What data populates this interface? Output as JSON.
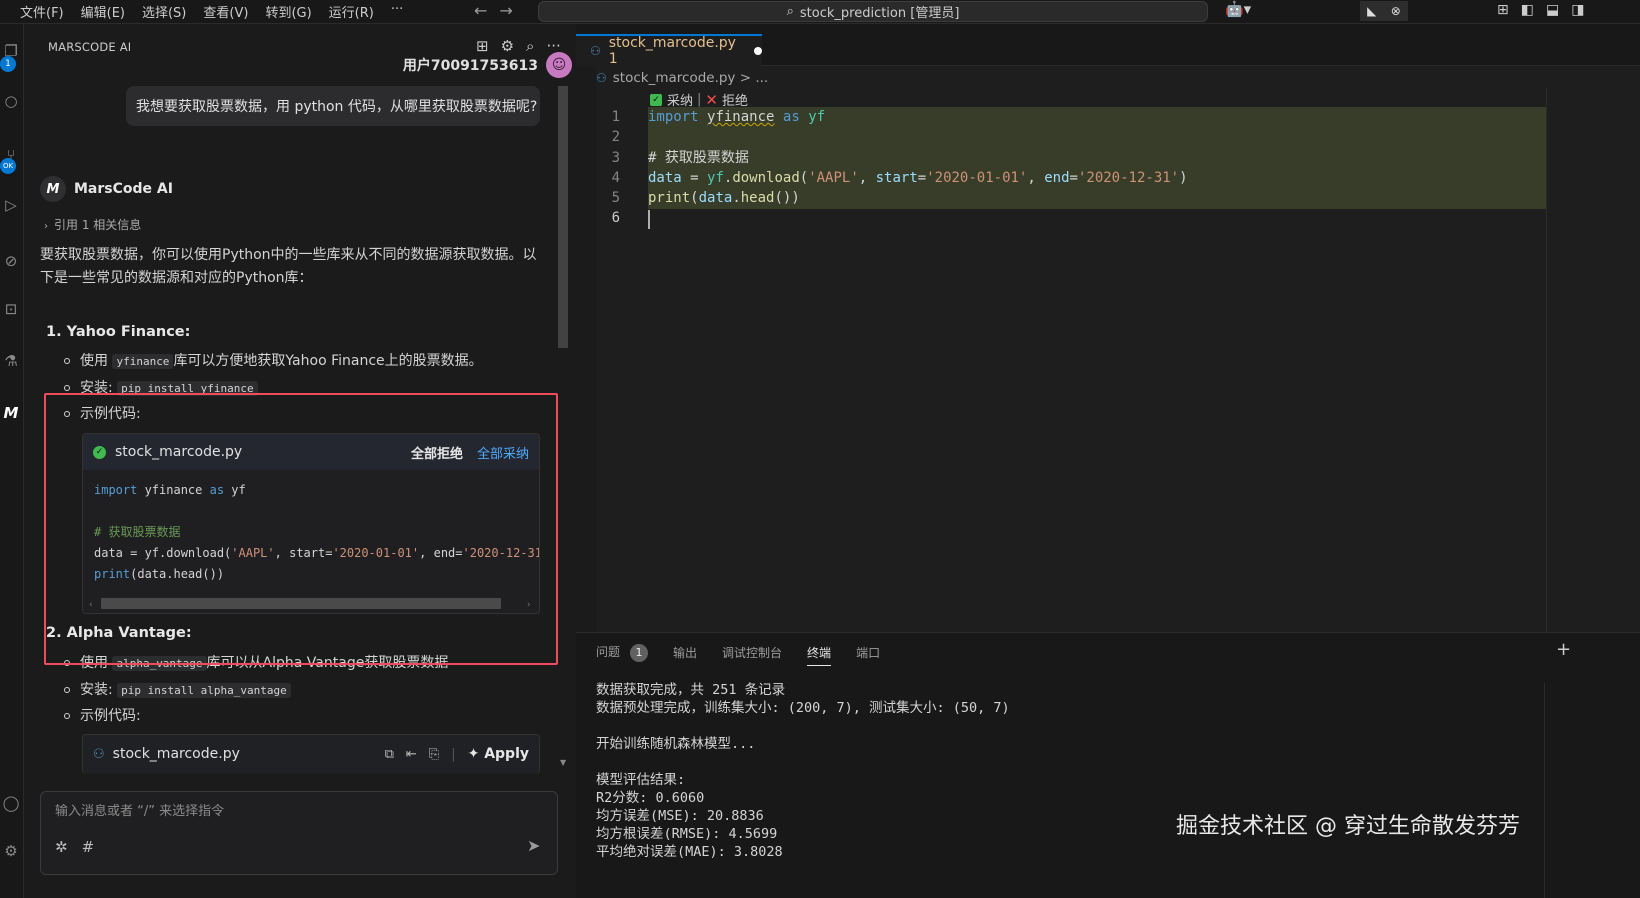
{
  "menu": [
    "文件(F)",
    "编辑(E)",
    "选择(S)",
    "查看(V)",
    "转到(G)",
    "运行(R)",
    "···"
  ],
  "search": {
    "title": "stock_prediction [管理员]"
  },
  "activity": {
    "badge_explorer": "1",
    "badge_ok": "OK"
  },
  "chat": {
    "header": "MARSCODE AI",
    "user_name": "用户70091753613",
    "user_message": "我想要获取股票数据，用 python 代码，从哪里获取股票数据呢?",
    "ai_name": "MarsCode AI",
    "ref_line": "引用 1 相关信息",
    "intro": "要获取股票数据，你可以使用Python中的一些库来从不同的数据源获取数据。以下是一些常见的数据源和对应的Python库：",
    "sections": [
      {
        "title": "1. Yahoo Finance:",
        "use_prefix": "使用",
        "use_code": "yfinance",
        "use_suffix": "库可以方便地获取Yahoo Finance上的股票数据。",
        "install_label": "安装:",
        "install_code": "pip install yfinance",
        "example_label": "示例代码:"
      },
      {
        "title": "2. Alpha Vantage:",
        "use_prefix": "使用",
        "use_code": "alpha_vantage",
        "use_suffix": "库可以从Alpha Vantage获取股票数据",
        "install_label": "安装:",
        "install_code": "pip install alpha_vantage",
        "example_label": "示例代码:"
      }
    ],
    "card1": {
      "filename": "stock_marcode.py",
      "reject_all": "全部拒绝",
      "accept_all": "全部采纳"
    },
    "card2": {
      "filename": "stock_marcode.py",
      "apply": "Apply"
    },
    "input_placeholder": "输入消息或者 “/” 来选择指令",
    "hash": "#"
  },
  "editor": {
    "tab_label": "stock_marcode.py 1",
    "breadcrumb": "stock_marcode.py > ...",
    "accept": "采纳",
    "separator": "|",
    "reject": "拒绝",
    "line_numbers": [
      "1",
      "2",
      "3",
      "4",
      "5",
      "6"
    ]
  },
  "panel": {
    "tabs": [
      "问题",
      "输出",
      "调试控制台",
      "终端",
      "端口"
    ],
    "problems_count": "1",
    "terminal_lines": [
      "数据获取完成，共 251 条记录",
      "数据预处理完成，训练集大小: (200, 7), 测试集大小: (50, 7)",
      "",
      "开始训练随机森林模型...",
      "",
      "模型评估结果:",
      "R2分数: 0.6060",
      "均方误差(MSE): 20.8836",
      "均方根误差(RMSE): 4.5699",
      "平均绝对误差(MAE): 3.8028"
    ]
  },
  "watermark": "掘金技术社区 @ 穿过生命散发芬芳"
}
